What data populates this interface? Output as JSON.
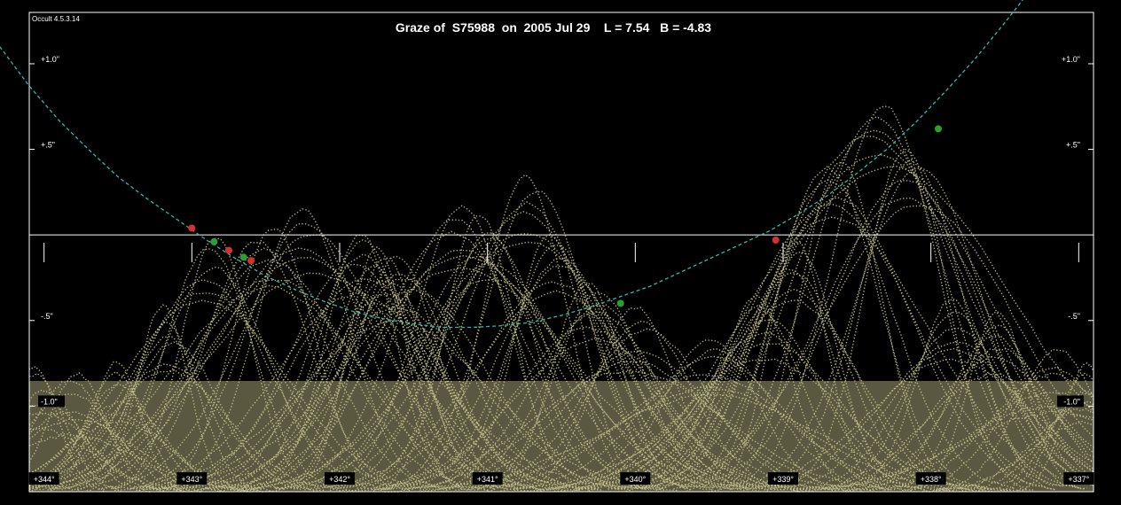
{
  "version": "Occult 4.5.3.14",
  "chart_data": {
    "type": "scatter",
    "title": "Graze of  S75988  on  2005 Jul 29    L = 7.54   B = -4.83",
    "x_label_values": [
      344,
      343,
      342,
      341,
      340,
      339,
      338,
      337
    ],
    "x_tick_labels": [
      "+344°",
      "+343°",
      "+342°",
      "+341°",
      "+340°",
      "+339°",
      "+338°",
      "+337°"
    ],
    "xlim": [
      344.1,
      336.9
    ],
    "y_tick_values": [
      1.0,
      0.5,
      -0.5,
      -1.0
    ],
    "y_tick_labels": [
      "+1.0\"",
      "+.5\"",
      "-.5\"",
      "-1.0\""
    ],
    "ylim": [
      -1.5,
      1.3
    ],
    "grid": false,
    "reference_line_y": 0,
    "colors": {
      "profile": "#c8c48e",
      "path": "#2fb8b0",
      "disappearance": "#d83030",
      "reappearance": "#2ca02c",
      "frame": "#ffffff",
      "background": "#000000"
    },
    "star_path": {
      "x": [
        344.3,
        344.1,
        343.9,
        343.7,
        343.5,
        343.3,
        343.1,
        342.9,
        342.7,
        342.5,
        342.3,
        342.1,
        341.9,
        341.7,
        341.5,
        341.3,
        341.1,
        340.9,
        340.7,
        340.5,
        340.3,
        340.1,
        339.9,
        339.7,
        339.5,
        339.3,
        339.1,
        338.9,
        338.7,
        338.5,
        338.3,
        338.1,
        337.9,
        337.7,
        337.5,
        337.3,
        337.1
      ],
      "y": [
        1.1,
        0.87,
        0.67,
        0.5,
        0.34,
        0.21,
        0.09,
        -0.03,
        -0.14,
        -0.24,
        -0.32,
        -0.39,
        -0.45,
        -0.49,
        -0.52,
        -0.54,
        -0.54,
        -0.53,
        -0.51,
        -0.47,
        -0.42,
        -0.36,
        -0.3,
        -0.22,
        -0.14,
        -0.06,
        0.02,
        0.12,
        0.23,
        0.36,
        0.5,
        0.66,
        0.84,
        1.03,
        1.24,
        1.46,
        1.68
      ]
    },
    "events": [
      {
        "type": "disappearance",
        "x": 343.0,
        "y": 0.04
      },
      {
        "type": "reappearance",
        "x": 342.85,
        "y": -0.04
      },
      {
        "type": "disappearance",
        "x": 342.75,
        "y": -0.09
      },
      {
        "type": "reappearance",
        "x": 342.65,
        "y": -0.13
      },
      {
        "type": "disappearance",
        "x": 342.6,
        "y": -0.15
      },
      {
        "type": "reappearance",
        "x": 340.1,
        "y": -0.4
      },
      {
        "type": "disappearance",
        "x": 339.05,
        "y": -0.03
      },
      {
        "type": "reappearance",
        "x": 337.95,
        "y": 0.62
      }
    ]
  }
}
